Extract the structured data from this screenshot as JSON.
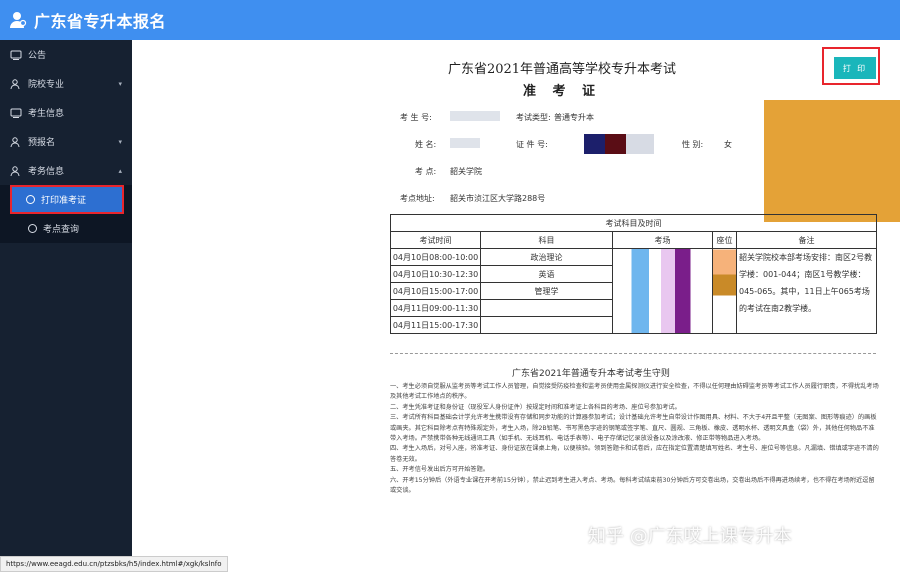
{
  "header": {
    "title": "广东省专升本报名"
  },
  "sidebar": {
    "items": [
      {
        "label": "公告"
      },
      {
        "label": "院校专业"
      },
      {
        "label": "考生信息"
      },
      {
        "label": "预报名"
      },
      {
        "label": "考务信息"
      }
    ],
    "sub_items": [
      {
        "label": "打印准考证"
      },
      {
        "label": "考点查询"
      }
    ]
  },
  "actions": {
    "print_label": "打 印"
  },
  "document": {
    "title": "广东省2021年普通高等学校专升本考试",
    "subtitle": "准 考 证",
    "fields": {
      "exam_no_label": "考 生 号:",
      "exam_type_label": "考试类型:",
      "exam_type_value": "普通专升本",
      "name_label": "姓  名:",
      "id_label": "证 件 号:",
      "gender_label": "性  别:",
      "gender_value": "女",
      "site_label": "考  点:",
      "site_value": "韶关学院",
      "address_label": "考点地址:",
      "address_value": "韶关市浈江区大学路288号"
    },
    "table": {
      "caption": "考试科目及时间",
      "headers": [
        "考试时间",
        "科目",
        "考场",
        "座位",
        "备注"
      ],
      "rows": [
        {
          "time": "04月10日08:00-10:00",
          "subject": "政治理论"
        },
        {
          "time": "04月10日10:30-12:30",
          "subject": "英语"
        },
        {
          "time": "04月10日15:00-17:00",
          "subject": "管理学"
        },
        {
          "time": "04月11日09:00-11:30",
          "subject": ""
        },
        {
          "time": "04月11日15:00-17:30",
          "subject": ""
        }
      ],
      "note": "韶关学院校本部考场安排：南区2号教学楼：001-044；南区1号教学楼：045-065。其中，11日上午065考场的考试在南2教学楼。"
    },
    "rules_title": "广东省2021年普通专升本考试考生守则",
    "rules": [
      "一、考生必须自觉服从监考员等考试工作人员管理，自觉接受防疫检查和监考员使用金属探测仪进行安全检查，不得以任何理由妨碍监考员等考试工作人员履行职责，不得扰乱考场及其他考试工作地点的秩序。",
      "二、考生凭准考证和身份证（现役军人身份证件）按规定时间和准考证上各科目的考场、座位号参加考试。",
      "三、考试所有科目基础会计学允许考生携带没有存储和同步功能的计算器参加考试；设计基础允许考生自带设计作图用具、材料、不大于4开且平整（无图案、图形等痕迹）的画板或画夹。其它科目除考点有特殊规定外，考生入场，除2B铅笔、书写黑色字迹的钢笔或签字笔、直尺、圆规、三角板、橡皮、透明水杯、透明文具盒（袋）外，其他任何物品不准带入考场。严禁携带各种无线通讯工具（如手机、无线耳机、电话手表等）、电子存储记忆录放设备以及涂改液、修正带等物品进入考场。",
      "四、考生入场后，对号入座，将准考证、身份证放在课桌上角，以便核验。领到答题卡和试卷后，应在指定位置清楚填写姓名、考生号、座位号等信息。凡漏填、错填或字迹不清的答卷无效。",
      "五、开考信号发出后方可开始答题。",
      "六、开考15分钟后（外语专业课在开考前15分钟），禁止迟到考生进入考点、考场。每科考试结束前30分钟后方可交卷出场，交卷出场后不得再进场续考，也不得在考场附近逗留或交谈。"
    ]
  },
  "watermark": "知乎 @广东哎上课专升本",
  "status_url": "https://www.eeagd.edu.cn/ptzsbks/h5/index.html#/xgk/kslnfo",
  "colors": {
    "header": "#3f8ff0",
    "sidebar": "#162131",
    "active": "#2d6fd1",
    "print": "#1ab6bb",
    "highlight": "#e8252d",
    "orange": "#e4a237"
  }
}
